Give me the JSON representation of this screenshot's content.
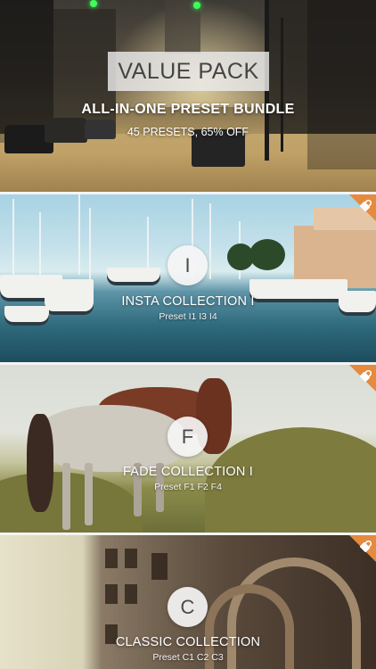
{
  "hero": {
    "title": "VALUE PACK",
    "subtitle": "ALL-IN-ONE PRESET BUNDLE",
    "offer": "45 PRESETS, 65% OFF"
  },
  "collections": [
    {
      "letter": "I",
      "title": "INSTA COLLECTION I",
      "presets": "Preset I1 I3 I4",
      "locked_icon": "lock-icon"
    },
    {
      "letter": "F",
      "title": "FADE COLLECTION I",
      "presets": "Preset F1 F2 F4",
      "locked_icon": "lock-icon"
    },
    {
      "letter": "C",
      "title": "CLASSIC COLLECTION",
      "presets": "Preset C1 C2 C3",
      "locked_icon": "lock-icon"
    }
  ],
  "colors": {
    "lock_badge": "#e58a3e",
    "separator": "#f4f4f4",
    "text_light": "#ffffff"
  }
}
